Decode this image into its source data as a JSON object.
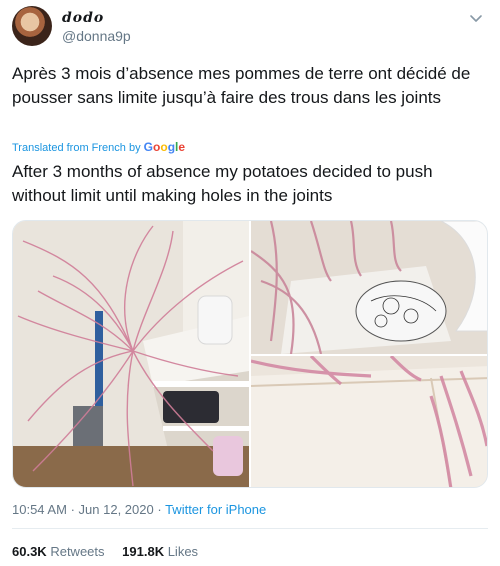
{
  "tweet": {
    "display_name": "dodo",
    "handle": "@donna9p",
    "original_text": "Après 3 mois d’absence mes pommes de terre ont décidé de pousser sans limite jusqu’à faire des trous dans les joints",
    "translated_from": "Translated from French by",
    "google_word": [
      "G",
      "o",
      "o",
      "g",
      "l",
      "e"
    ],
    "translation": "After 3 months of absence my potatoes decided to push without limit until making holes in the joints",
    "time": "10:54 AM",
    "separator": "·",
    "date": "Jun 12, 2020",
    "source": "Twitter for iPhone",
    "retweets_count": "60.3K",
    "retweets_label": "Retweets",
    "likes_count": "191.8K",
    "likes_label": "Likes"
  },
  "colors": {
    "link": "#1b95e0",
    "secondary": "#657786",
    "text": "#14171a"
  },
  "icons": {
    "chevron": "chevron-down-icon"
  }
}
